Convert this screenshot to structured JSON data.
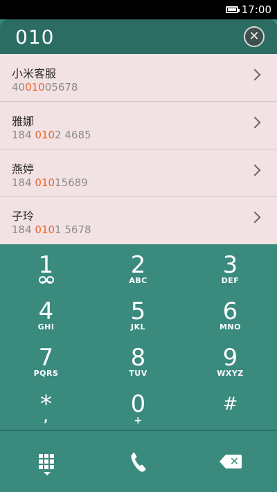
{
  "status": {
    "time": "17:00"
  },
  "search": {
    "query": "010",
    "clear_icon": "close-icon"
  },
  "results": [
    {
      "name": "小米客服",
      "pre": "40",
      "hl": "010",
      "post": "05678"
    },
    {
      "name": "雅娜",
      "pre": "184 ",
      "hl": "010",
      "post": "2 4685"
    },
    {
      "name": "燕婷",
      "pre": "184 ",
      "hl": "010",
      "post": "15689"
    },
    {
      "name": "子玲",
      "pre": "184 ",
      "hl": "010",
      "post": "1 5678"
    }
  ],
  "keys": [
    {
      "digit": "1",
      "letters": "",
      "icon": "voicemail-icon"
    },
    {
      "digit": "2",
      "letters": "ABC"
    },
    {
      "digit": "3",
      "letters": "DEF"
    },
    {
      "digit": "4",
      "letters": "GHI"
    },
    {
      "digit": "5",
      "letters": "JKL"
    },
    {
      "digit": "6",
      "letters": "MNO"
    },
    {
      "digit": "7",
      "letters": "PQRS"
    },
    {
      "digit": "8",
      "letters": "TUV"
    },
    {
      "digit": "9",
      "letters": "WXYZ"
    },
    {
      "digit": "*",
      "letters": ","
    },
    {
      "digit": "0",
      "letters": "+"
    },
    {
      "digit": "#",
      "letters": ""
    }
  ],
  "bottom": {
    "left_icon": "dialpad-toggle-icon",
    "center_icon": "call-icon",
    "right_icon": "backspace-icon"
  },
  "colors": {
    "accent": "#3a8a7e",
    "highlight": "#e8652b",
    "list_bg": "#f3e2e4"
  }
}
